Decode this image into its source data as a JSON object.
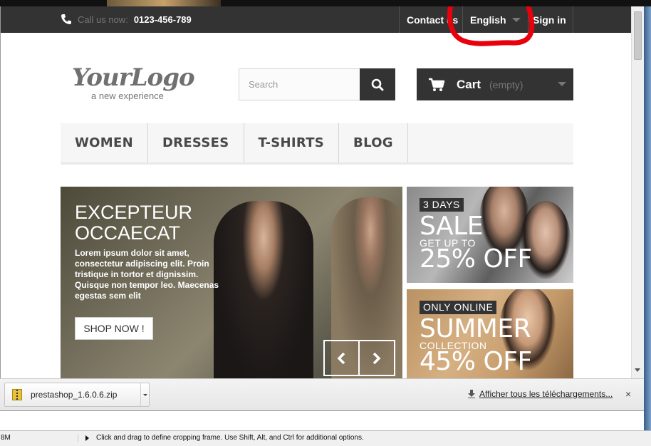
{
  "topbar": {
    "phone_label": "Call us now:",
    "phone_number": "0123-456-789",
    "contact_label": "Contact us",
    "language_label": "English",
    "signin_label": "Sign in"
  },
  "header": {
    "logo_text": "YourLogo",
    "logo_tagline": "a new experience",
    "search_placeholder": "Search",
    "cart_label": "Cart",
    "cart_status": "(empty)"
  },
  "menu": {
    "items": [
      {
        "label": "WOMEN"
      },
      {
        "label": "DRESSES"
      },
      {
        "label": "T-SHIRTS"
      },
      {
        "label": "BLOG"
      }
    ]
  },
  "slider": {
    "title_line1": "EXCEPTEUR",
    "title_line2": "OCCAECAT",
    "text": "Lorem ipsum dolor sit amet, consectetur adipiscing elit. Proin tristique in tortor et dignissim. Quisque non tempor leo. Maecenas egestas sem elit",
    "button_label": "SHOP NOW !"
  },
  "banners": [
    {
      "badge": "3 DAYS",
      "big": "SALE",
      "small": "GET UP TO",
      "offer": "25% OFF"
    },
    {
      "badge": "ONLY ONLINE",
      "big": "SUMMER",
      "small": "COLLECTION",
      "offer": "45% OFF"
    }
  ],
  "downloads": {
    "file_name": "prestashop_1.6.0.6.zip",
    "show_all_label": "Afficher tous les téléchargements...",
    "close_symbol": "×"
  },
  "statusbar": {
    "zoom": "8M",
    "hint": "Click and drag to define cropping frame. Use Shift, Alt, and Ctrl for additional options."
  },
  "colors": {
    "topbar_bg": "#333333",
    "annotation": "#e8000d",
    "menu_bg": "#f6f6f6"
  }
}
